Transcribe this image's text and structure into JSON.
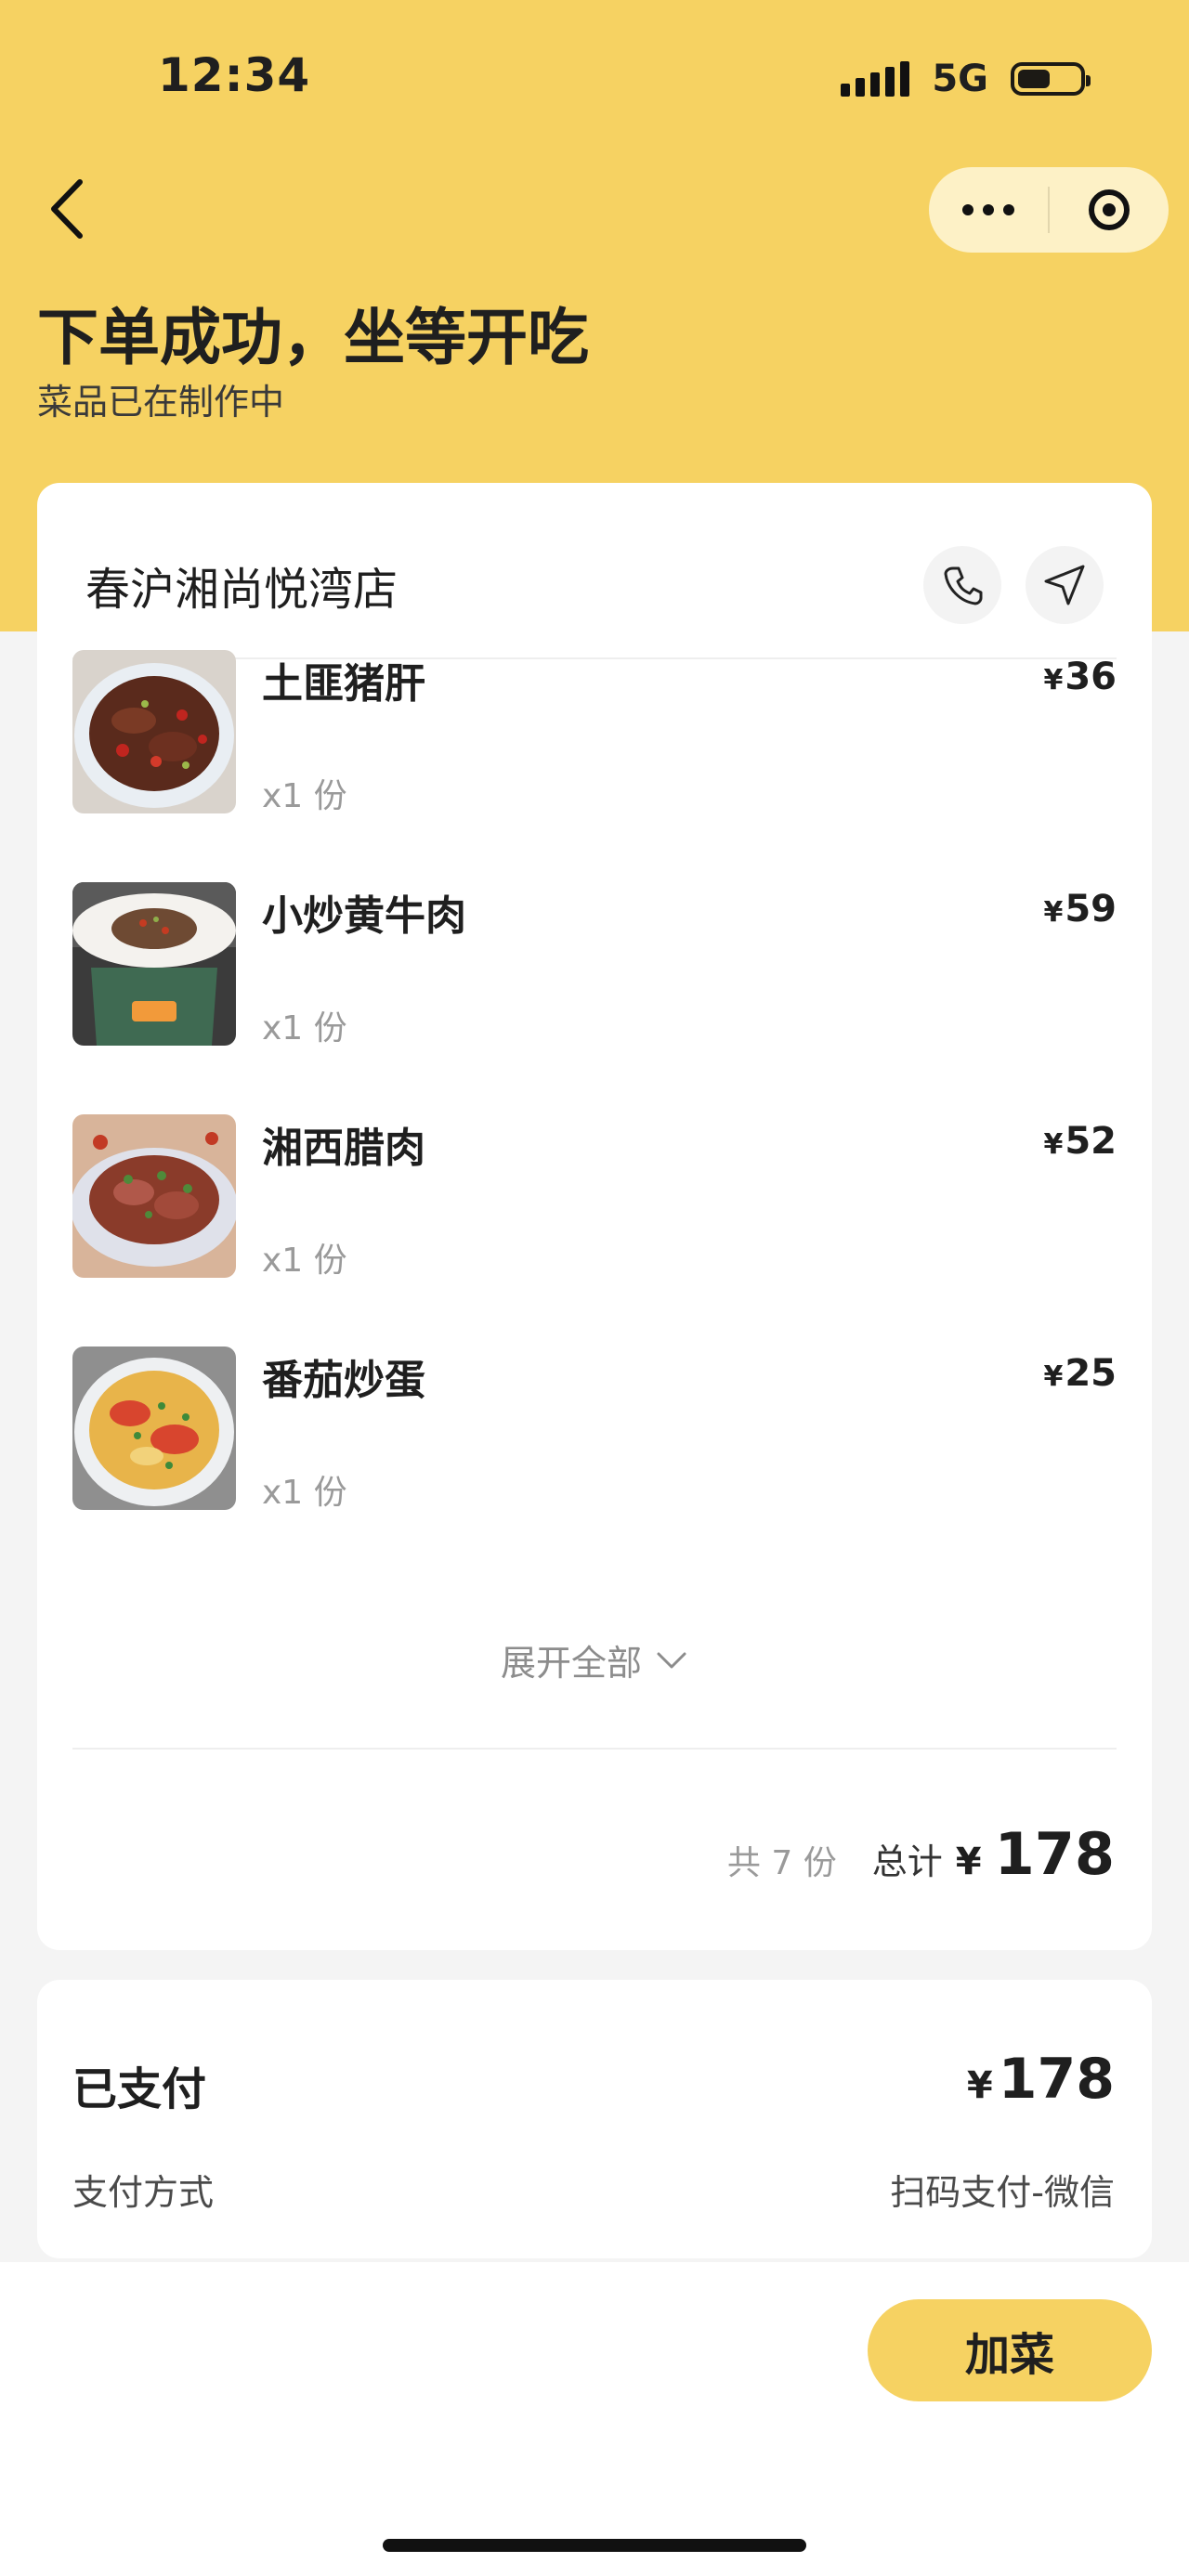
{
  "status_bar": {
    "time": "12:34",
    "network": "5G"
  },
  "header": {
    "title": "下单成功，坐等开吃",
    "subtitle": "菜品已在制作中"
  },
  "shop": {
    "name": "春沪湘尚悦湾店"
  },
  "items": [
    {
      "name": "土匪猪肝",
      "qty": "x1 份",
      "yen": "¥",
      "price": "36"
    },
    {
      "name": "小炒黄牛肉",
      "qty": "x1 份",
      "yen": "¥",
      "price": "59"
    },
    {
      "name": "湘西腊肉",
      "qty": "x1 份",
      "yen": "¥",
      "price": "52"
    },
    {
      "name": "番茄炒蛋",
      "qty": "x1 份",
      "yen": "¥",
      "price": "25"
    }
  ],
  "expand_label": "展开全部",
  "summary": {
    "count": "共 7 份",
    "total_label": "总计",
    "yen": "¥",
    "total": "178"
  },
  "payment": {
    "paid_label": "已支付",
    "yen": "¥",
    "paid_amount": "178",
    "method_label": "支付方式",
    "method_value": "扫码支付-微信"
  },
  "actions": {
    "add_label": "加菜"
  },
  "colors": {
    "accent": "#f6d262",
    "background": "#f4f4f4"
  }
}
